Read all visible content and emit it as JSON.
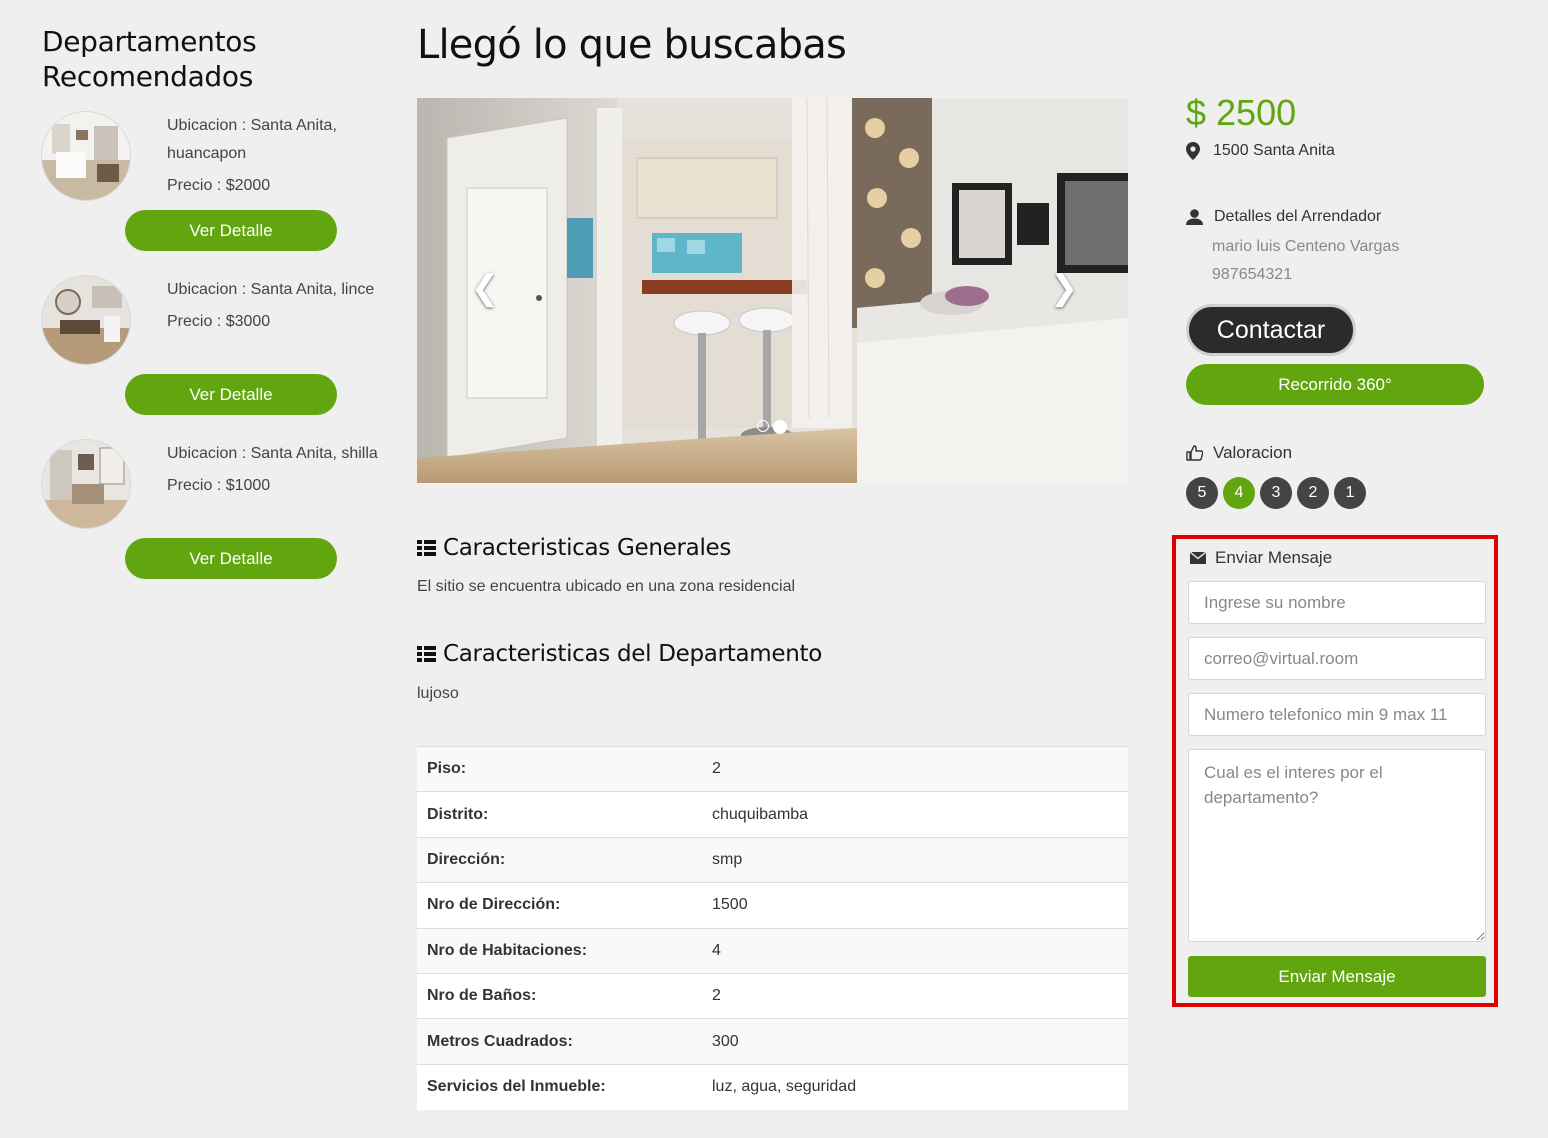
{
  "sidebar": {
    "title": "Departamentos Recomendados",
    "items": [
      {
        "ubicacion": "Ubicacion : Santa Anita, huancapon",
        "precio": "Precio : $2000",
        "button": "Ver Detalle"
      },
      {
        "ubicacion": "Ubicacion : Santa Anita, lince",
        "precio": "Precio : $3000",
        "button": "Ver Detalle"
      },
      {
        "ubicacion": "Ubicacion : Santa Anita, shilla",
        "precio": "Precio : $1000",
        "button": "Ver Detalle"
      }
    ]
  },
  "main": {
    "title": "Llegó lo que buscabas",
    "carousel": {
      "prev_icon": "chevron-left-icon",
      "next_icon": "chevron-right-icon"
    },
    "general": {
      "heading": "Caracteristicas Generales",
      "text": "El sitio se encuentra ubicado en una zona residencial"
    },
    "depto": {
      "heading": "Caracteristicas del Departamento",
      "text": "lujoso"
    },
    "specs": [
      {
        "label": "Piso:",
        "value": "2"
      },
      {
        "label": "Distrito:",
        "value": "chuquibamba"
      },
      {
        "label": "Dirección:",
        "value": "smp"
      },
      {
        "label": "Nro de Dirección:",
        "value": "1500"
      },
      {
        "label": "Nro de Habitaciones:",
        "value": "4"
      },
      {
        "label": "Nro de Baños:",
        "value": "2"
      },
      {
        "label": "Metros Cuadrados:",
        "value": "300"
      },
      {
        "label": "Servicios del Inmueble:",
        "value": "luz, agua, seguridad"
      }
    ]
  },
  "aside": {
    "price": "$ 2500",
    "address": "1500 Santa Anita",
    "owner_heading": "Detalles del Arrendador",
    "owner_name": "mario luis Centeno Vargas",
    "owner_phone": "987654321",
    "contact_button": "Contactar",
    "tour_button": "Recorrido 360°",
    "rating_heading": "Valoracion",
    "rating_options": [
      "5",
      "4",
      "3",
      "2",
      "1"
    ],
    "rating_selected": "4",
    "message": {
      "heading": "Enviar Mensaje",
      "name_placeholder": "Ingrese su nombre",
      "email_placeholder": "correo@virtual.room",
      "phone_placeholder": "Numero telefonico min 9 max 11",
      "interest_placeholder": "Cual es el interes por el departamento?",
      "submit": "Enviar Mensaje"
    }
  },
  "colors": {
    "accent": "#61a60e",
    "dark_button": "#2b2b2b",
    "highlight_border": "#e00000"
  }
}
